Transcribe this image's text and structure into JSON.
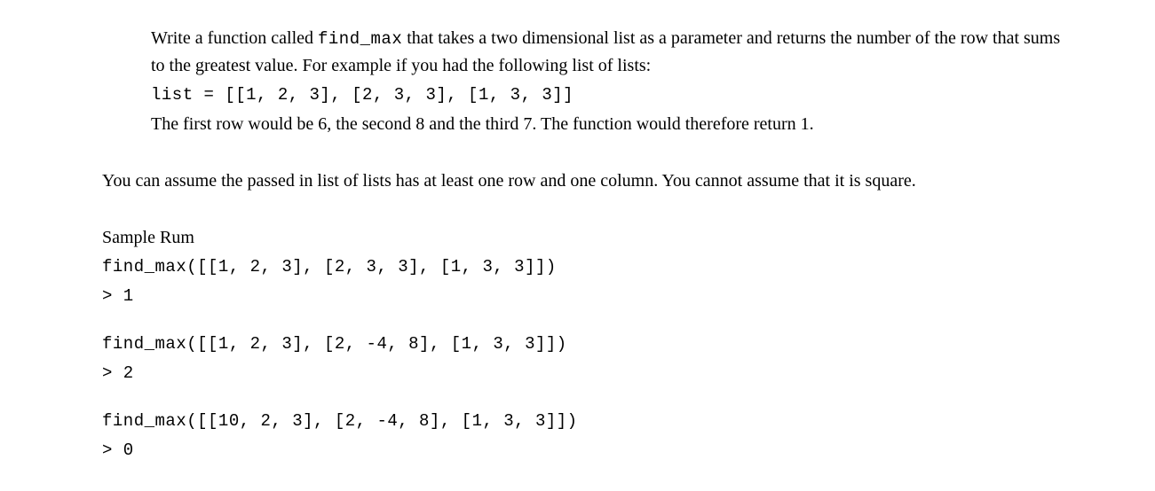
{
  "problem": {
    "intro_part1": "Write a function called ",
    "func_name": "find_max",
    "intro_part2": " that takes a two dimensional list as a parameter and returns the number of the row that sums to the greatest value. For example if you had the following list of lists:",
    "example_list": "list = [[1, 2, 3], [2, 3, 3], [1, 3, 3]]",
    "explain": " The first row would be 6, the second 8 and the third 7. The function would therefore return 1.",
    "assumptions": "You can assume the passed in list of lists has at least one row and one column. You cannot assume that it is square."
  },
  "sample": {
    "heading": "Sample Rum",
    "runs": [
      {
        "call": "find_max([[1, 2, 3], [2, 3, 3], [1, 3, 3]])",
        "output": "> 1"
      },
      {
        "call": "find_max([[1, 2, 3], [2, -4, 8], [1, 3, 3]])",
        "output": "> 2"
      },
      {
        "call": "find_max([[10, 2, 3], [2, -4, 8], [1, 3, 3]])",
        "output": "> 0"
      }
    ]
  }
}
